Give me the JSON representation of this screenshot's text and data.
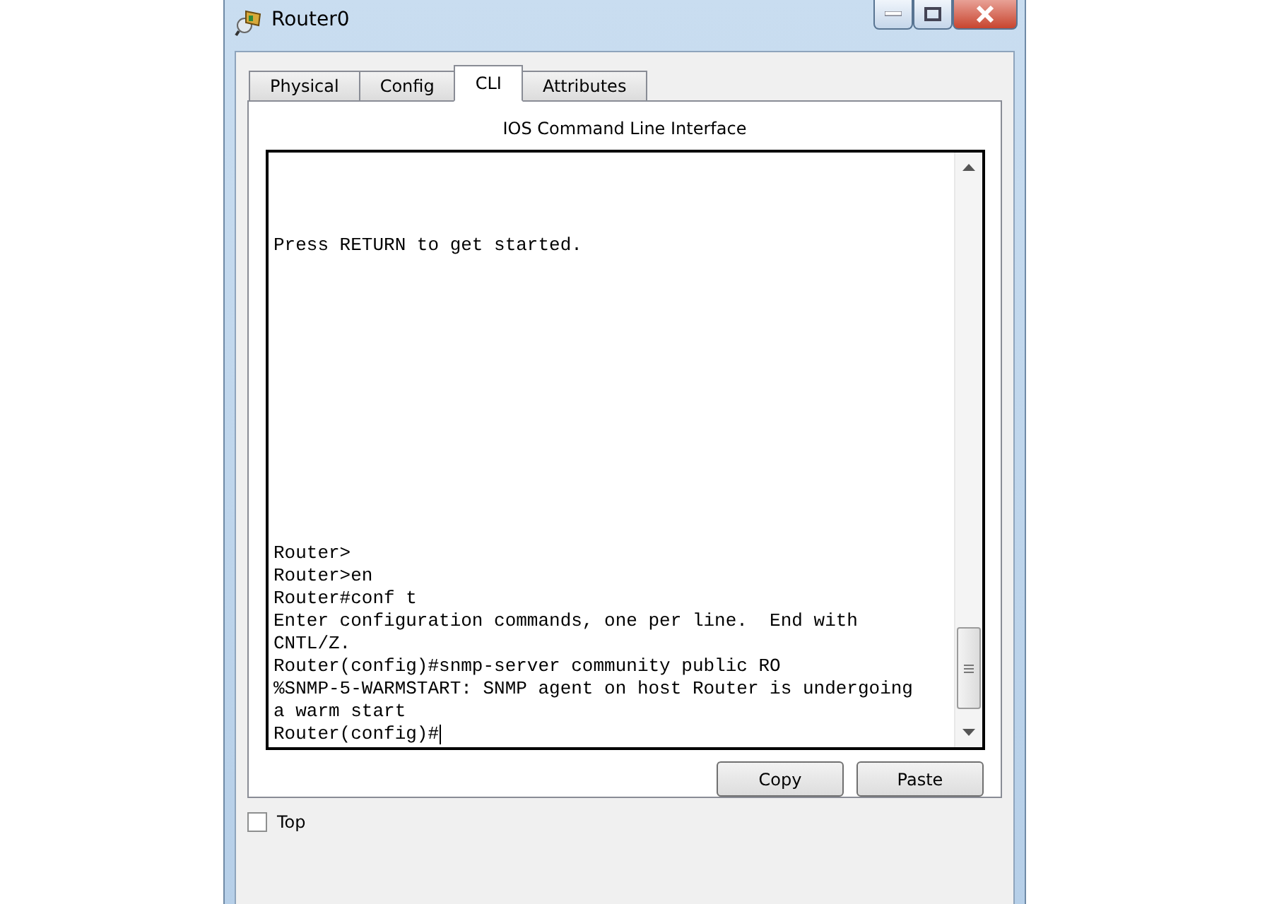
{
  "window": {
    "title": "Router0"
  },
  "tabs": [
    {
      "label": "Physical",
      "selected": false
    },
    {
      "label": "Config",
      "selected": false
    },
    {
      "label": "CLI",
      "selected": true
    },
    {
      "label": "Attributes",
      "selected": false
    }
  ],
  "panel_title": "IOS Command Line Interface",
  "console": {
    "banner": "Press RETURN to get started.",
    "lines": [
      "Router>",
      "Router>en",
      "Router#conf t",
      "Enter configuration commands, one per line.  End with",
      "CNTL/Z.",
      "Router(config)#snmp-server community public RO",
      "%SNMP-5-WARMSTART: SNMP agent on host Router is undergoing",
      "a warm start",
      "Router(config)#"
    ]
  },
  "buttons": [
    "Copy",
    "Paste"
  ],
  "top_checkbox": {
    "label": "Top",
    "checked": false
  }
}
